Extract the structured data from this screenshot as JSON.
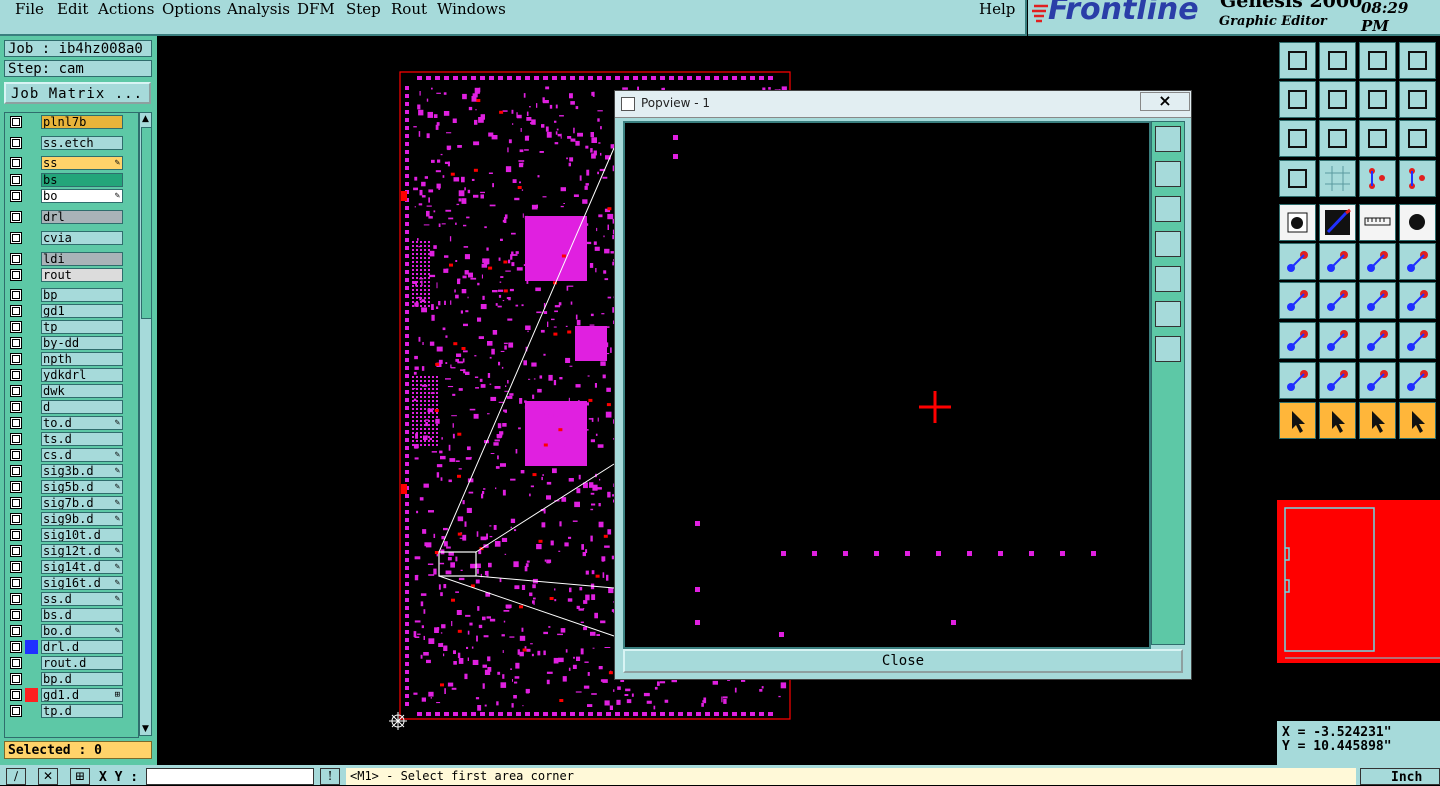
{
  "menu": {
    "file": "File",
    "edit": "Edit",
    "actions": "Actions",
    "options": "Options",
    "analysis": "Analysis",
    "dfm": "DFM",
    "step": "Step",
    "rout": "Rout",
    "windows": "Windows",
    "help": "Help"
  },
  "brand": {
    "logo": "Frontline",
    "product": "Genesis 2000",
    "editor": "Graphic Editor",
    "time": "08:29 PM"
  },
  "job": {
    "job_label": "Job : ib4hz008a0",
    "step_label": "Step: cam",
    "matrix_button": "Job Matrix ..."
  },
  "layers": [
    {
      "name": "plnl7b",
      "color": "#e8b43a",
      "swatch": null,
      "tag": ""
    },
    {
      "name": "ss.etch",
      "color": "#a6dada",
      "swatch": null,
      "tag": ""
    },
    {
      "name": "ss",
      "color": "#ffd36a",
      "swatch": null,
      "tag": "✎"
    },
    {
      "name": "bs",
      "color": "#23a57a",
      "swatch": null,
      "tag": ""
    },
    {
      "name": "bo",
      "color": "#ffffff",
      "swatch": null,
      "tag": "✎"
    },
    {
      "name": "drl",
      "color": "#a9b3b8",
      "swatch": null,
      "tag": ""
    },
    {
      "name": "cvia",
      "color": "#a6dada",
      "swatch": null,
      "tag": ""
    },
    {
      "name": "ldi",
      "color": "#a9b3b8",
      "swatch": null,
      "tag": ""
    },
    {
      "name": "rout",
      "color": "#dcdcdc",
      "swatch": null,
      "tag": ""
    },
    {
      "name": "bp",
      "color": "#a6dada",
      "swatch": null,
      "tag": ""
    },
    {
      "name": "gd1",
      "color": "#a6dada",
      "swatch": null,
      "tag": ""
    },
    {
      "name": "tp",
      "color": "#a6dada",
      "swatch": null,
      "tag": ""
    },
    {
      "name": "by-dd",
      "color": "#a6dada",
      "swatch": null,
      "tag": ""
    },
    {
      "name": "npth",
      "color": "#a6dada",
      "swatch": null,
      "tag": ""
    },
    {
      "name": "ydkdrl",
      "color": "#a6dada",
      "swatch": null,
      "tag": ""
    },
    {
      "name": "dwk",
      "color": "#a6dada",
      "swatch": null,
      "tag": ""
    },
    {
      "name": "d",
      "color": "#a6dada",
      "swatch": null,
      "tag": ""
    },
    {
      "name": "to.d",
      "color": "#a6dada",
      "swatch": null,
      "tag": "✎"
    },
    {
      "name": "ts.d",
      "color": "#a6dada",
      "swatch": null,
      "tag": ""
    },
    {
      "name": "cs.d",
      "color": "#a6dada",
      "swatch": null,
      "tag": "✎"
    },
    {
      "name": "sig3b.d",
      "color": "#a6dada",
      "swatch": null,
      "tag": "✎"
    },
    {
      "name": "sig5b.d",
      "color": "#a6dada",
      "swatch": null,
      "tag": "✎"
    },
    {
      "name": "sig7b.d",
      "color": "#a6dada",
      "swatch": null,
      "tag": "✎"
    },
    {
      "name": "sig9b.d",
      "color": "#a6dada",
      "swatch": null,
      "tag": "✎"
    },
    {
      "name": "sig10t.d",
      "color": "#a6dada",
      "swatch": null,
      "tag": ""
    },
    {
      "name": "sig12t.d",
      "color": "#a6dada",
      "swatch": null,
      "tag": "✎"
    },
    {
      "name": "sig14t.d",
      "color": "#a6dada",
      "swatch": null,
      "tag": "✎"
    },
    {
      "name": "sig16t.d",
      "color": "#a6dada",
      "swatch": null,
      "tag": "✎"
    },
    {
      "name": "ss.d",
      "color": "#a6dada",
      "swatch": null,
      "tag": "✎"
    },
    {
      "name": "bs.d",
      "color": "#a6dada",
      "swatch": null,
      "tag": ""
    },
    {
      "name": "bo.d",
      "color": "#a6dada",
      "swatch": null,
      "tag": "✎"
    },
    {
      "name": "drl.d",
      "color": "#a6dada",
      "swatch": "#2030ff",
      "tag": ""
    },
    {
      "name": "rout.d",
      "color": "#a6dada",
      "swatch": null,
      "tag": ""
    },
    {
      "name": "bp.d",
      "color": "#a6dada",
      "swatch": null,
      "tag": ""
    },
    {
      "name": "gd1.d",
      "color": "#a6dada",
      "swatch": "#ff2020",
      "tag": "⊞"
    },
    {
      "name": "tp.d",
      "color": "#a6dada",
      "swatch": null,
      "tag": ""
    }
  ],
  "selected_label": "Selected : 0",
  "popview": {
    "title": "Popview - 1",
    "close_x": "×",
    "close_button": "Close"
  },
  "bottom": {
    "xy_label": "X Y :",
    "xy_value": "",
    "status": "<M1> - Select first area corner",
    "unit": "Inch"
  },
  "coords": {
    "x": "X = -3.524231\"",
    "y": "Y = 10.445898\""
  },
  "colors": {
    "panel": "#a6dada",
    "panel_dark": "#5dc8a6",
    "feature": "#e020e0",
    "highlight": "#ff0000"
  },
  "toolbar_icons": [
    "zoom-home-icon",
    "zoom-fit-icon",
    "home-icon",
    "window-split-icon",
    "pan-left-icon",
    "pan-right-icon",
    "mirror-icon",
    "snap-icon",
    "zoom-extent-icon",
    "zoom-center-icon",
    "scale-1-2-icon",
    "help-icon",
    "measure-tool-icon",
    "grid-icon",
    "layer-red-icon",
    "layer-red-2-icon",
    "pad-select-icon",
    "line-draw-icon",
    "ruler-icon",
    "circle-dot-icon",
    "net-nodes-icon",
    "cross-icon",
    "connect-icon",
    "connect-2-icon",
    "angle-icon",
    "slash-icon",
    "rotate-icon",
    "split-icon",
    "point-box-icon",
    "minus-icon",
    "dimension-icon",
    "clone-icon",
    "triangle-icon",
    "triangle-arrow-icon",
    "triangle-up-icon",
    "triangle-cross-icon",
    "select-cursor-icon",
    "select-box-icon",
    "select-circle-icon",
    "select-net-icon"
  ]
}
